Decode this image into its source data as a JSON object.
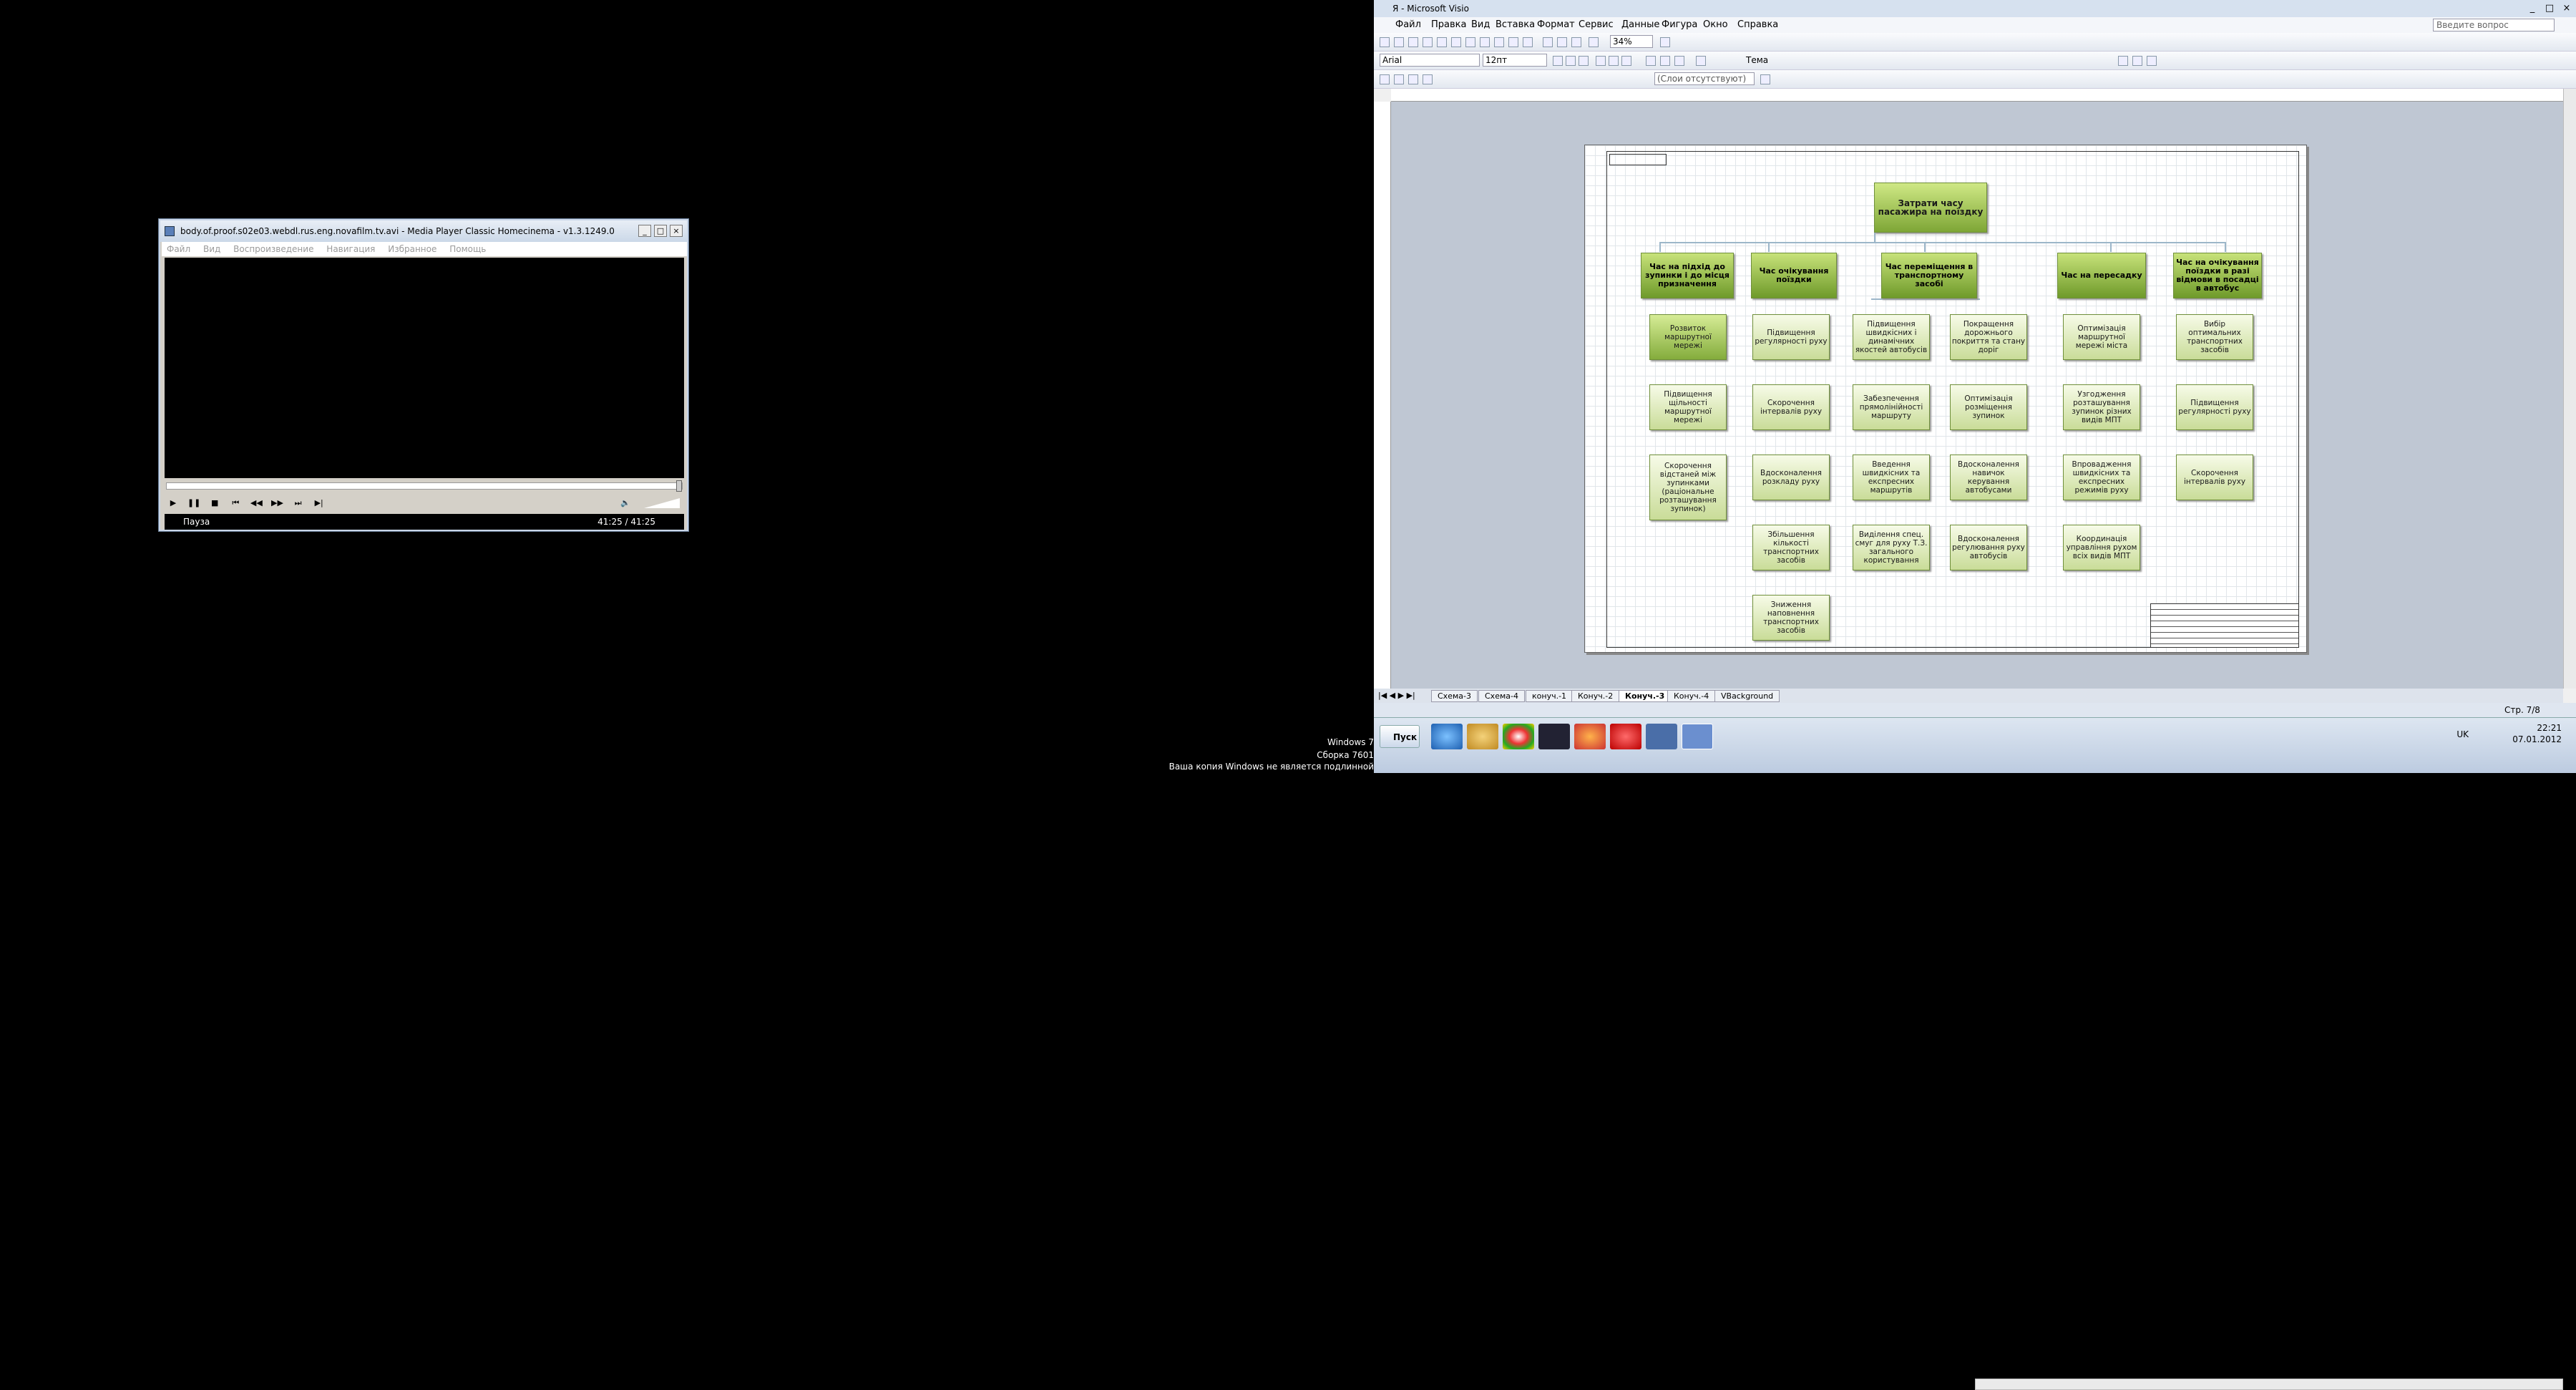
{
  "mpc": {
    "title": "body.of.proof.s02e03.webdl.rus.eng.novafilm.tv.avi - Media Player Classic Homecinema - v1.3.1249.0",
    "menu": [
      "Файл",
      "Вид",
      "Воспроизведение",
      "Навигация",
      "Избранное",
      "Помощь"
    ],
    "status": "Пауза",
    "time": "41:25 / 41:25",
    "seek_fraction": 1.0
  },
  "visio": {
    "title": "Я - Microsoft Visio",
    "menu": [
      "Файл",
      "Правка",
      "Вид",
      "Вставка",
      "Формат",
      "Сервис",
      "Данные",
      "Фигура",
      "Окно",
      "Справка"
    ],
    "help_placeholder": "Введите вопрос",
    "zoom": "34%",
    "font_name": "Arial",
    "font_size": "12пт",
    "theme_label": "Тема",
    "layer_combo": "(Слои отсутствуют)",
    "tabs": [
      "Схема-3",
      "Схема-4",
      "конуч.-1",
      "Конуч.-2",
      "Конуч.-3",
      "Конуч.-4",
      "VBackground"
    ],
    "active_tab_index": 4,
    "page_status": "Стр. 7/8",
    "chart": {
      "top": "Затрати часу пасажира на поїздку",
      "groups": [
        {
          "head": "Час на підхід до зупинки і до місця призначення",
          "items": [
            "Розвиток маршрутної мережі",
            "Підвищення щільності маршрутної мережі",
            "Скорочення відстаней між зупинками (раціональне розташування зупинок)"
          ]
        },
        {
          "head": "Час очікування поїздки",
          "items": [
            "Підвищення регулярності руху",
            "Скорочення інтервалів руху",
            "Вдосконалення розкладу руху",
            "Збільшення кількості транспортних засобів",
            "Зниження наповнення транспортних засобів"
          ]
        },
        {
          "head": "Час переміщення в транспортному засобі",
          "items": [
            "Підвищення швидкісних і динамічних якостей автобусів",
            "Забезпечення прямолінійності маршруту",
            "Введення швидкісних та експресних маршрутів",
            "Виділення спец. смуг для руху Т.З. загального користування"
          ],
          "items2": [
            "Покращення дорожнього покриття та стану доріг",
            "Оптимізація розміщення зупинок",
            "Вдосконалення навичок керування автобусами",
            "Вдосконалення регулювання руху автобусів"
          ]
        },
        {
          "head": "Час на пересадку",
          "items": [
            "Оптимізація маршрутної мережі міста",
            "Узгодження розташування зупинок різних видів МПТ",
            "Впровадження швидкісних та експресних режимів руху",
            "Координація управління рухом всіх видів МПТ"
          ]
        },
        {
          "head": "Час на очікування поїздки в разі відмови в посадці в автобус",
          "items": [
            "Вибір оптимальних транспортних засобів",
            "Підвищення регулярності руху",
            "Скорочення інтервалів руху"
          ]
        }
      ]
    }
  },
  "taskbar": {
    "start": "Пуск",
    "lang": "UK",
    "time": "22:21",
    "date": "07.01.2012"
  },
  "watermark": {
    "line1": "Windows 7",
    "line2": "Сборка 7601",
    "line3": "Ваша копия Windows не является подлинной"
  }
}
